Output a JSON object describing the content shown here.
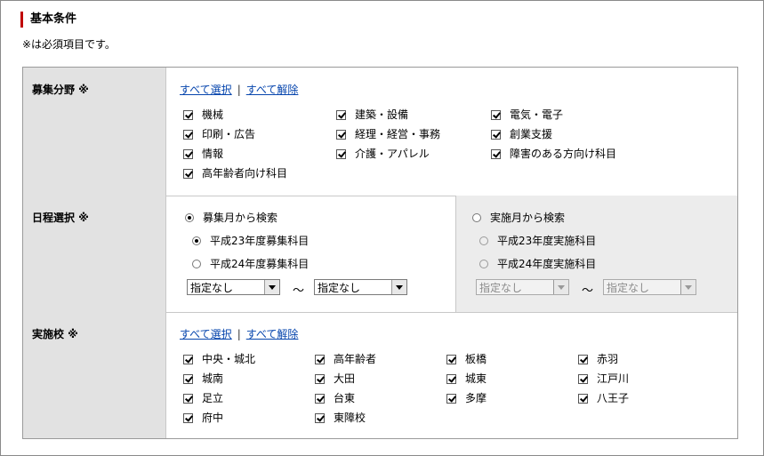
{
  "header": {
    "title": "基本条件",
    "note": "※は必須項目です。"
  },
  "field": {
    "select_all": "すべて選択",
    "clear_all": "すべて解除",
    "separator": "|",
    "recruit": {
      "label": "募集分野 ※",
      "items": [
        "機械",
        "建築・設備",
        "電気・電子",
        "印刷・広告",
        "経理・経営・事務",
        "創業支援",
        "情報",
        "介護・アパレル",
        "障害のある方向け科目",
        "高年齢者向け科目"
      ]
    },
    "schedule": {
      "label": "日程選択 ※",
      "left": {
        "main": "募集月から検索",
        "opt1": "平成23年度募集科目",
        "opt2": "平成24年度募集科目",
        "from": "指定なし",
        "to": "指定なし"
      },
      "right": {
        "main": "実施月から検索",
        "opt1": "平成23年度実施科目",
        "opt2": "平成24年度実施科目",
        "from": "指定なし",
        "to": "指定なし"
      },
      "tilde": "～"
    },
    "school": {
      "label": "実施校 ※",
      "items": [
        "中央・城北",
        "高年齢者",
        "板橋",
        "赤羽",
        "城南",
        "大田",
        "城東",
        "江戸川",
        "足立",
        "台東",
        "多摩",
        "八王子",
        "府中",
        "東障校"
      ]
    }
  }
}
